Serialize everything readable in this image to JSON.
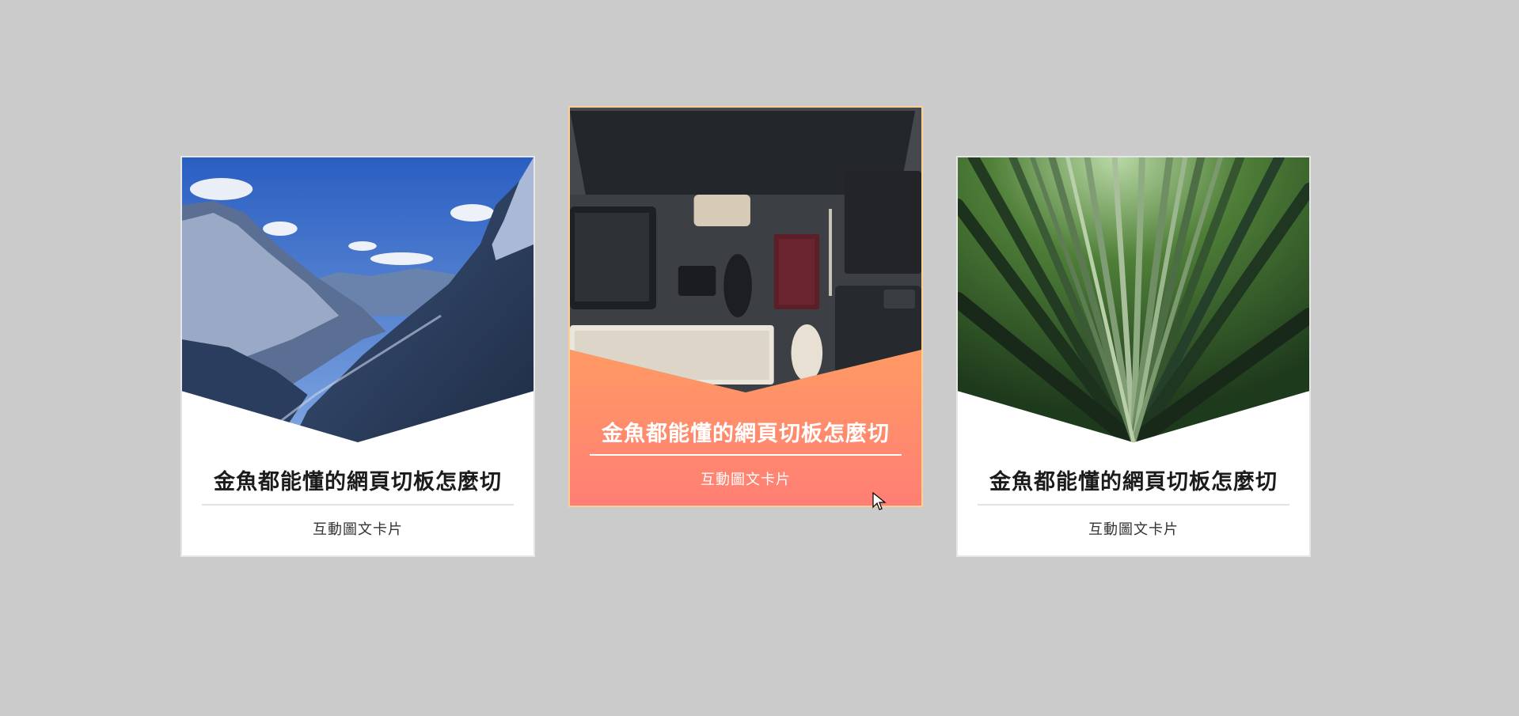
{
  "colors": {
    "background": "#cbcbcb",
    "card_background": "#ffffff",
    "hover_gradient_top": "#ffb25c",
    "hover_gradient_bottom": "#ff7f74",
    "title_text": "#1b1b1b"
  },
  "cards": [
    {
      "image": "mountain-landscape",
      "title": "金魚都能懂的網頁切板怎麼切",
      "subtitle": "互動圖文卡片",
      "state": "default"
    },
    {
      "image": "desk-workspace",
      "title": "金魚都能懂的網頁切板怎麼切",
      "subtitle": "互動圖文卡片",
      "state": "hover"
    },
    {
      "image": "bamboo-forest",
      "title": "金魚都能懂的網頁切板怎麼切",
      "subtitle": "互動圖文卡片",
      "state": "default"
    }
  ],
  "cursor": "arrow-cursor-icon"
}
